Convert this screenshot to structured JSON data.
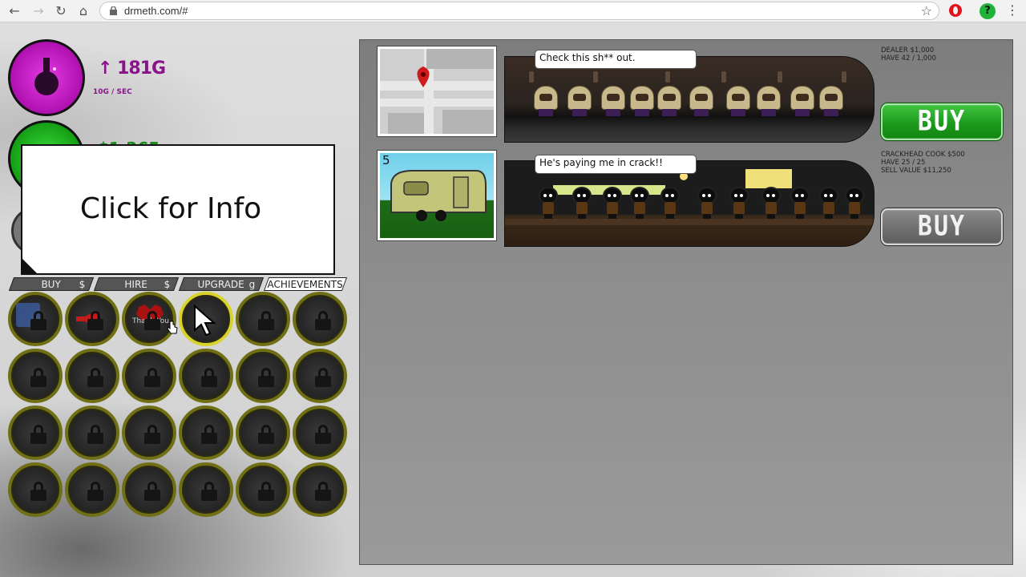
{
  "browser": {
    "url": "drmeth.com/#",
    "ext_label": "?"
  },
  "stats": {
    "g_value": "↑ 181G",
    "g_rate": "10G / SEC",
    "cash_value": "$1,265"
  },
  "info_box": {
    "text": "Click for Info"
  },
  "tabs": [
    {
      "label": "BUY",
      "currency": "$"
    },
    {
      "label": "HIRE",
      "currency": "$"
    },
    {
      "label": "UPGRADE",
      "currency": "g"
    },
    {
      "label": "ACHIEVEMENTS",
      "currency": ""
    }
  ],
  "achievements": {
    "heart_text": "Thank You",
    "slots": [
      {
        "state": "facebook"
      },
      {
        "state": "megaphone"
      },
      {
        "state": "heart"
      },
      {
        "state": "cursor"
      },
      {
        "state": "locked"
      },
      {
        "state": "locked"
      },
      {
        "state": "locked"
      },
      {
        "state": "locked"
      },
      {
        "state": "locked"
      },
      {
        "state": "locked"
      },
      {
        "state": "locked"
      },
      {
        "state": "locked"
      },
      {
        "state": "locked"
      },
      {
        "state": "locked"
      },
      {
        "state": "locked"
      },
      {
        "state": "locked"
      },
      {
        "state": "locked"
      },
      {
        "state": "locked"
      },
      {
        "state": "locked"
      },
      {
        "state": "locked"
      },
      {
        "state": "locked"
      },
      {
        "state": "locked"
      },
      {
        "state": "locked"
      },
      {
        "state": "locked"
      }
    ]
  },
  "shop": [
    {
      "speech": "Check this sh** out.",
      "info_lines": [
        "DEALER $1,000",
        "HAVE 42 / 1,000"
      ],
      "buy_label": "BUY",
      "enabled": true,
      "workers_shown": 10
    },
    {
      "speech": "He's paying me in crack!!",
      "thumb_count": "5",
      "info_lines": [
        "CRACKHEAD COOK $500",
        "HAVE 25 / 25",
        "SELL VALUE $11,250"
      ],
      "buy_label": "BUY",
      "enabled": false,
      "workers_shown": 11
    }
  ],
  "colors": {
    "g_purple": "#8a128a",
    "cash_green": "#1a8a1a",
    "buy_green": "#1c9a1c",
    "buy_disabled": "#6f6f6f",
    "achievement_ring": "#706f16",
    "achievement_ring_highlight": "#d8d22a"
  }
}
